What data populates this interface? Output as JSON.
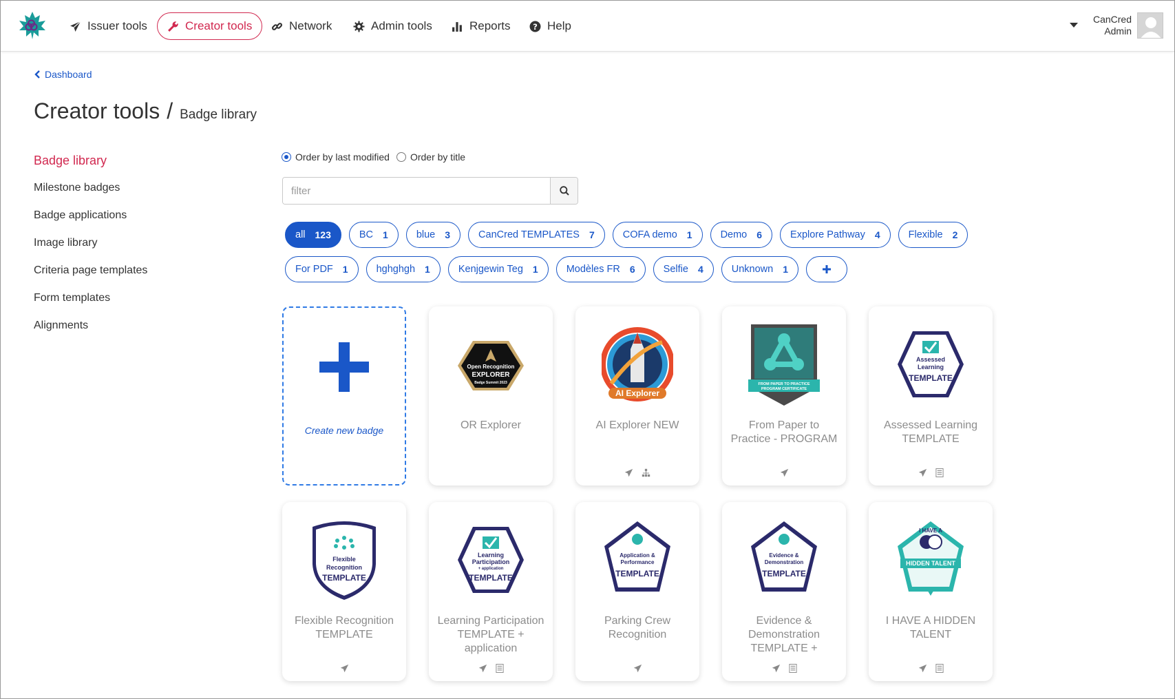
{
  "nav": {
    "items": [
      {
        "label": "Issuer tools",
        "icon": "send-icon"
      },
      {
        "label": "Creator tools",
        "icon": "wrench-icon",
        "active": true
      },
      {
        "label": "Network",
        "icon": "link-icon"
      },
      {
        "label": "Admin tools",
        "icon": "gear-icon"
      },
      {
        "label": "Reports",
        "icon": "bar-chart-icon"
      },
      {
        "label": "Help",
        "icon": "question-icon"
      }
    ],
    "user": {
      "line1": "CanCred",
      "line2": "Admin"
    }
  },
  "breadcrumb": {
    "label": "Dashboard"
  },
  "page": {
    "title": "Creator tools",
    "separator": "/",
    "subtitle": "Badge library"
  },
  "sidebar": {
    "items": [
      {
        "label": "Badge library",
        "active": true
      },
      {
        "label": "Milestone badges"
      },
      {
        "label": "Badge applications"
      },
      {
        "label": "Image library"
      },
      {
        "label": "Criteria page templates"
      },
      {
        "label": "Form templates"
      },
      {
        "label": "Alignments"
      }
    ]
  },
  "order": {
    "last_modified": "Order by last modified",
    "title": "Order by title",
    "selected": "last_modified"
  },
  "filter": {
    "placeholder": "filter",
    "value": ""
  },
  "tags": [
    {
      "label": "all",
      "count": "123",
      "active": true
    },
    {
      "label": "BC",
      "count": "1"
    },
    {
      "label": "blue",
      "count": "3"
    },
    {
      "label": "CanCred TEMPLATES",
      "count": "7"
    },
    {
      "label": "COFA demo",
      "count": "1"
    },
    {
      "label": "Demo",
      "count": "6"
    },
    {
      "label": "Explore Pathway",
      "count": "4"
    },
    {
      "label": "Flexible",
      "count": "2"
    },
    {
      "label": "For PDF",
      "count": "1"
    },
    {
      "label": "hghghgh",
      "count": "1"
    },
    {
      "label": "Kenjgewin Teg",
      "count": "1"
    },
    {
      "label": "Modèles FR",
      "count": "6"
    },
    {
      "label": "Selfie",
      "count": "4"
    },
    {
      "label": "Unknown",
      "count": "1"
    }
  ],
  "create_badge": {
    "label": "Create new badge"
  },
  "badges": [
    {
      "title": "OR Explorer",
      "art": {
        "type": "hex-black",
        "lines": [
          "Open Recognition",
          "EXPLORER",
          "Badge Summit 2023"
        ]
      },
      "actions": []
    },
    {
      "title": "AI Explorer NEW",
      "art": {
        "type": "rocket",
        "lines": [
          "AI Explorer"
        ]
      },
      "actions": [
        "send-icon",
        "sitemap-icon"
      ]
    },
    {
      "title": "From Paper to Practice - PROGRAM",
      "art": {
        "type": "shield-teal",
        "lines": [
          "FROM PAPER TO PRACTICE",
          "PROGRAM CERTIFICATE"
        ]
      },
      "actions": [
        "send-icon"
      ]
    },
    {
      "title": "Assessed Learning TEMPLATE",
      "art": {
        "type": "hex-navy",
        "lines": [
          "Assessed",
          "Learning",
          "TEMPLATE"
        ]
      },
      "actions": [
        "send-icon",
        "list-icon"
      ]
    },
    {
      "title": "Flexible Recognition TEMPLATE",
      "art": {
        "type": "shield-navy",
        "lines": [
          "Flexible",
          "Recognition",
          "TEMPLATE"
        ]
      },
      "actions": [
        "send-icon"
      ]
    },
    {
      "title": "Learning Participation TEMPLATE + application",
      "art": {
        "type": "hex-navy",
        "lines": [
          "Learning",
          "Participation",
          "+ application",
          "TEMPLATE"
        ]
      },
      "actions": [
        "send-icon",
        "list-icon"
      ]
    },
    {
      "title": "Parking Crew Recognition",
      "art": {
        "type": "pent-navy",
        "lines": [
          "Application &",
          "Performance",
          "TEMPLATE"
        ]
      },
      "actions": [
        "send-icon"
      ]
    },
    {
      "title": "Evidence & Demonstration TEMPLATE +",
      "art": {
        "type": "pent-navy",
        "lines": [
          "Evidence &",
          "Demonstration",
          "TEMPLATE"
        ]
      },
      "actions": [
        "send-icon",
        "list-icon"
      ]
    },
    {
      "title": "I HAVE A HIDDEN TALENT",
      "art": {
        "type": "pent-teal",
        "lines": [
          "I HAVE A",
          "HIDDEN TALENT"
        ]
      },
      "actions": [
        "send-icon",
        "list-icon"
      ]
    }
  ],
  "colors": {
    "accent_red": "#d1284f",
    "link_blue": "#1a57c8",
    "navy": "#2b2a6b",
    "teal": "#2bb5ac"
  }
}
